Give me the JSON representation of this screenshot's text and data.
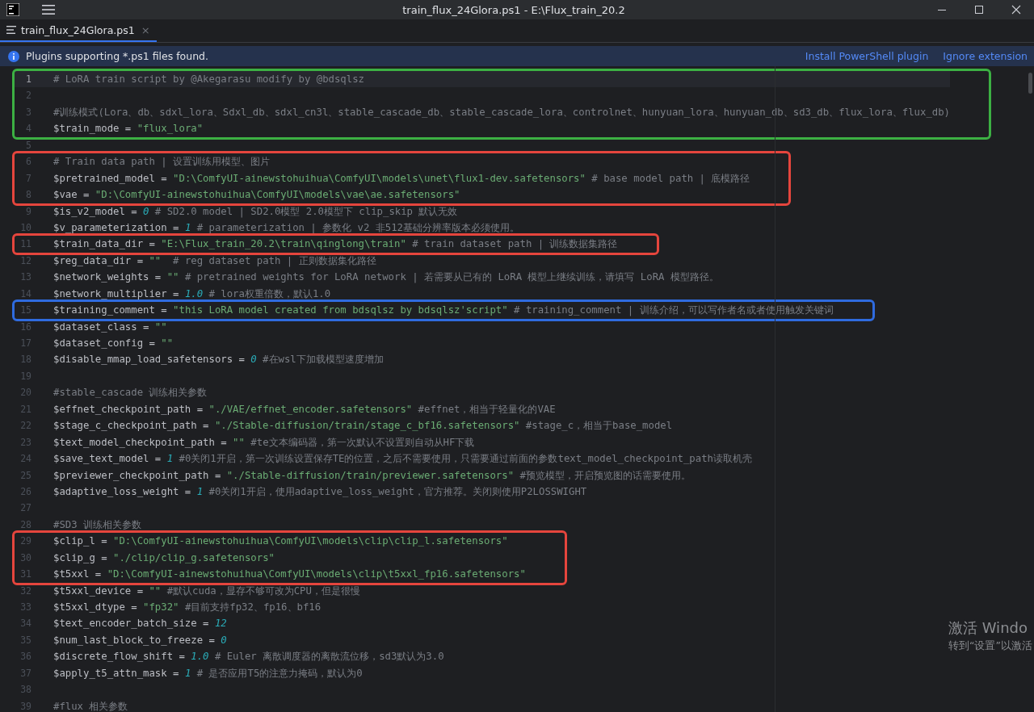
{
  "window": {
    "title": "train_flux_24Glora.ps1 - E:\\Flux_train_20.2"
  },
  "tabs": [
    {
      "label": "train_flux_24Glora.ps1",
      "close": "×",
      "selected": true
    }
  ],
  "notification": {
    "message": "Plugins supporting *.ps1 files found.",
    "actions": [
      "Install PowerShell plugin",
      "Ignore extension"
    ]
  },
  "editor": {
    "blocks": [
      {
        "kind": "boxed",
        "color": "#3cb043",
        "lines": [
          {
            "number": "1",
            "current": true,
            "tokens": [
              {
                "kind": "comment",
                "text": "# LoRA train script by @Akegarasu modify by @bdsqlsz"
              }
            ]
          },
          {
            "number": "2",
            "current": false
          },
          {
            "number": "3",
            "current": false,
            "tokens": [
              {
                "kind": "comment",
                "text": "#训练模式(Lora、db、sdxl_lora、Sdxl_db、sdxl_cn3l、stable_cascade_db、stable_cascade_lora、controlnet、hunyuan_lora、hunyuan_db、sd3_db、flux_lora、flux_db)"
              }
            ]
          },
          {
            "number": "4",
            "current": false,
            "tokens": [
              {
                "kind": "text",
                "text": "$train_mode = "
              },
              {
                "kind": "string",
                "text": "\"flux_lora\""
              }
            ]
          }
        ]
      },
      {
        "kind": "plain",
        "lines": [
          {
            "number": "5",
            "current": false
          }
        ]
      },
      {
        "kind": "boxed",
        "color": "#e5453d",
        "lines": [
          {
            "number": "6",
            "current": false,
            "tokens": [
              {
                "kind": "comment",
                "text": "# Train data path | 设置训练用模型、图片"
              }
            ]
          },
          {
            "number": "7",
            "current": false,
            "tokens": [
              {
                "kind": "text",
                "text": "$pretrained_model = "
              },
              {
                "kind": "string",
                "text": "\"D:\\ComfyUI-ainewstohuihua\\ComfyUI\\models\\unet\\flux1-dev.safetensors\""
              },
              {
                "kind": "comment",
                "text": " # base model path | 底模路径"
              }
            ]
          },
          {
            "number": "8",
            "current": false,
            "tokens": [
              {
                "kind": "text",
                "text": "$vae = "
              },
              {
                "kind": "string",
                "text": "\"D:\\ComfyUI-ainewstohuihua\\ComfyUI\\models\\vae\\ae.safetensors\""
              }
            ]
          }
        ]
      },
      {
        "kind": "plain",
        "lines": [
          {
            "number": "9",
            "current": false,
            "tokens": [
              {
                "kind": "text",
                "text": "$is_v2_model = "
              },
              {
                "kind": "number",
                "text": "0"
              },
              {
                "kind": "comment",
                "text": " # SD2.0 model | SD2.0模型 2.0模型下 clip_skip 默认无效"
              }
            ]
          },
          {
            "number": "10",
            "current": false,
            "tokens": [
              {
                "kind": "text",
                "text": "$v_parameterization = "
              },
              {
                "kind": "number",
                "text": "1"
              },
              {
                "kind": "comment",
                "text": " # parameterization | 参数化 v2 非512基础分辨率版本必须使用。"
              }
            ]
          }
        ]
      },
      {
        "kind": "boxed",
        "color": "#e5453d",
        "lines": [
          {
            "number": "11",
            "current": false,
            "tokens": [
              {
                "kind": "text",
                "text": "$train_data_dir = "
              },
              {
                "kind": "string",
                "text": "\"E:\\Flux_train_20.2\\train\\qinglong\\train\""
              },
              {
                "kind": "comment",
                "text": " # train dataset path | 训练数据集路径"
              }
            ]
          }
        ]
      },
      {
        "kind": "plain",
        "lines": [
          {
            "number": "12",
            "current": false,
            "tokens": [
              {
                "kind": "text",
                "text": "$reg_data_dir = "
              },
              {
                "kind": "string",
                "text": "\"\""
              },
              {
                "kind": "comment",
                "text": "  # reg dataset path | 正则数据集化路径"
              }
            ]
          },
          {
            "number": "13",
            "current": false,
            "tokens": [
              {
                "kind": "text",
                "text": "$network_weights = "
              },
              {
                "kind": "string",
                "text": "\"\""
              },
              {
                "kind": "comment",
                "text": " # pretrained weights for LoRA network | 若需要从已有的 LoRA 模型上继续训练，请填写 LoRA 模型路径。"
              }
            ]
          },
          {
            "number": "14",
            "current": false,
            "tokens": [
              {
                "kind": "text",
                "text": "$network_multiplier = "
              },
              {
                "kind": "number",
                "text": "1.0"
              },
              {
                "kind": "comment",
                "text": " # lora权重倍数，默认1.0"
              }
            ]
          }
        ]
      },
      {
        "kind": "boxed",
        "color": "#2f6bdf",
        "lines": [
          {
            "number": "15",
            "current": false,
            "tokens": [
              {
                "kind": "text",
                "text": "$training_comment = "
              },
              {
                "kind": "string",
                "text": "\"this LoRA model created from bdsqlsz by bdsqlsz'script\""
              },
              {
                "kind": "comment",
                "text": " # training_comment | 训练介绍，可以写作者名或者使用触发关键词"
              }
            ]
          }
        ]
      },
      {
        "kind": "plain",
        "lines": [
          {
            "number": "16",
            "current": false,
            "tokens": [
              {
                "kind": "text",
                "text": "$dataset_class = "
              },
              {
                "kind": "string",
                "text": "\"\""
              }
            ]
          },
          {
            "number": "17",
            "current": false,
            "tokens": [
              {
                "kind": "text",
                "text": "$dataset_config = "
              },
              {
                "kind": "string",
                "text": "\"\""
              }
            ]
          },
          {
            "number": "18",
            "current": false,
            "tokens": [
              {
                "kind": "text",
                "text": "$disable_mmap_load_safetensors = "
              },
              {
                "kind": "number",
                "text": "0"
              },
              {
                "kind": "comment",
                "text": " #在wsl下加载模型速度增加"
              }
            ]
          },
          {
            "number": "19",
            "current": false
          },
          {
            "number": "20",
            "current": false,
            "tokens": [
              {
                "kind": "comment",
                "text": "#stable_cascade 训练相关参数"
              }
            ]
          },
          {
            "number": "21",
            "current": false,
            "tokens": [
              {
                "kind": "text",
                "text": "$effnet_checkpoint_path = "
              },
              {
                "kind": "string",
                "text": "\"./VAE/effnet_encoder.safetensors\""
              },
              {
                "kind": "comment",
                "text": " #effnet，相当于轻量化的VAE"
              }
            ]
          },
          {
            "number": "22",
            "current": false,
            "tokens": [
              {
                "kind": "text",
                "text": "$stage_c_checkpoint_path = "
              },
              {
                "kind": "string",
                "text": "\"./Stable-diffusion/train/stage_c_bf16.safetensors\""
              },
              {
                "kind": "comment",
                "text": " #stage_c，相当于base_model"
              }
            ]
          },
          {
            "number": "23",
            "current": false,
            "tokens": [
              {
                "kind": "text",
                "text": "$text_model_checkpoint_path = "
              },
              {
                "kind": "string",
                "text": "\"\""
              },
              {
                "kind": "comment",
                "text": " #te文本编码器，第一次默认不设置则自动从HF下载"
              }
            ]
          },
          {
            "number": "24",
            "current": false,
            "tokens": [
              {
                "kind": "text",
                "text": "$save_text_model = "
              },
              {
                "kind": "number",
                "text": "1"
              },
              {
                "kind": "comment",
                "text": " #0关闭1开启，第一次训练设置保存TE的位置，之后不需要使用，只需要通过前面的参数text_model_checkpoint_path读取机壳"
              }
            ]
          },
          {
            "number": "25",
            "current": false,
            "tokens": [
              {
                "kind": "text",
                "text": "$previewer_checkpoint_path = "
              },
              {
                "kind": "string",
                "text": "\"./Stable-diffusion/train/previewer.safetensors\""
              },
              {
                "kind": "comment",
                "text": " #预览模型，开启预览图的话需要使用。"
              }
            ]
          },
          {
            "number": "26",
            "current": false,
            "tokens": [
              {
                "kind": "text",
                "text": "$adaptive_loss_weight = "
              },
              {
                "kind": "number",
                "text": "1"
              },
              {
                "kind": "comment",
                "text": " #0关闭1开启，使用adaptive_loss_weight，官方推荐。关闭则使用P2LOSSWIGHT"
              }
            ]
          },
          {
            "number": "27",
            "current": false
          },
          {
            "number": "28",
            "current": false,
            "tokens": [
              {
                "kind": "comment",
                "text": "#SD3 训练相关参数"
              }
            ]
          }
        ]
      },
      {
        "kind": "boxed",
        "color": "#e5453d",
        "lines": [
          {
            "number": "29",
            "current": false,
            "tokens": [
              {
                "kind": "text",
                "text": "$clip_l = "
              },
              {
                "kind": "string",
                "text": "\"D:\\ComfyUI-ainewstohuihua\\ComfyUI\\models\\clip\\clip_l.safetensors\""
              }
            ]
          },
          {
            "number": "30",
            "current": false,
            "tokens": [
              {
                "kind": "text",
                "text": "$clip_g = "
              },
              {
                "kind": "string",
                "text": "\"./clip/clip_g.safetensors\""
              }
            ]
          },
          {
            "number": "31",
            "current": false,
            "tokens": [
              {
                "kind": "text",
                "text": "$t5xxl = "
              },
              {
                "kind": "string",
                "text": "\"D:\\ComfyUI-ainewstohuihua\\ComfyUI\\models\\clip\\t5xxl_fp16.safetensors\""
              }
            ]
          }
        ]
      },
      {
        "kind": "plain",
        "lines": [
          {
            "number": "32",
            "current": false,
            "tokens": [
              {
                "kind": "text",
                "text": "$t5xxl_device = "
              },
              {
                "kind": "string",
                "text": "\"\""
              },
              {
                "kind": "comment",
                "text": " #默认cuda，显存不够可改为CPU，但是很慢"
              }
            ]
          },
          {
            "number": "33",
            "current": false,
            "tokens": [
              {
                "kind": "text",
                "text": "$t5xxl_dtype = "
              },
              {
                "kind": "string",
                "text": "\"fp32\""
              },
              {
                "kind": "comment",
                "text": " #目前支持fp32、fp16、bf16"
              }
            ]
          },
          {
            "number": "34",
            "current": false,
            "tokens": [
              {
                "kind": "text",
                "text": "$text_encoder_batch_size = "
              },
              {
                "kind": "number",
                "text": "12"
              }
            ]
          },
          {
            "number": "35",
            "current": false,
            "tokens": [
              {
                "kind": "text",
                "text": "$num_last_block_to_freeze = "
              },
              {
                "kind": "number",
                "text": "0"
              }
            ]
          },
          {
            "number": "36",
            "current": false,
            "tokens": [
              {
                "kind": "text",
                "text": "$discrete_flow_shift = "
              },
              {
                "kind": "number",
                "text": "1.0"
              },
              {
                "kind": "comment",
                "text": " # Euler 离散调度器的离散流位移，sd3默认为3.0"
              }
            ]
          },
          {
            "number": "37",
            "current": false,
            "tokens": [
              {
                "kind": "text",
                "text": "$apply_t5_attn_mask = "
              },
              {
                "kind": "number",
                "text": "1"
              },
              {
                "kind": "comment",
                "text": " # 是否应用T5的注意力掩码，默认为0"
              }
            ]
          },
          {
            "number": "38",
            "current": false
          },
          {
            "number": "39",
            "current": false,
            "tokens": [
              {
                "kind": "comment",
                "text": "#flux 相关参数"
              }
            ]
          }
        ]
      }
    ]
  },
  "os_overlay": {
    "title": "激活 Windo",
    "subtitle": "转到“设置”以激活"
  }
}
